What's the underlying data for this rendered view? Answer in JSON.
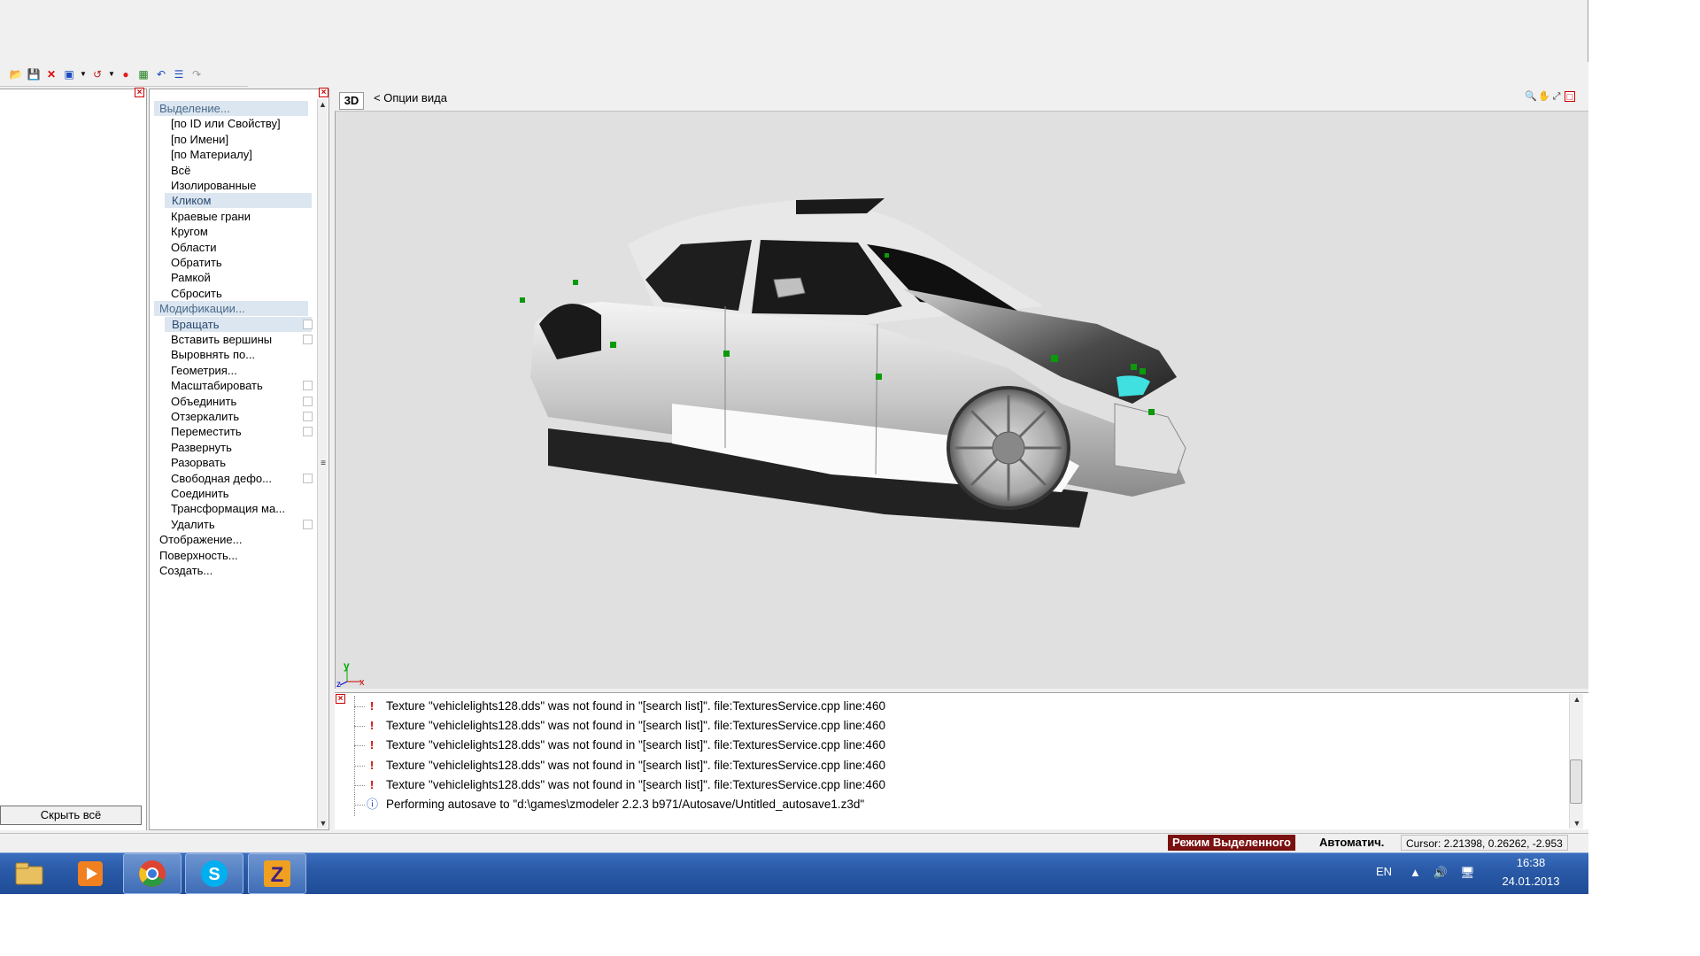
{
  "toolbar": {
    "icons": [
      "open-icon",
      "save-icon",
      "delete-icon",
      "import-icon",
      "dropdown-arrow",
      "undo-group-icon",
      "dropdown-arrow",
      "record-icon",
      "render-icon",
      "undo-icon",
      "properties-icon",
      "redo-icon"
    ]
  },
  "left_panel": {
    "hide_all_button": "Скрыть всё"
  },
  "tree": {
    "sections": [
      {
        "label": "Выделение...",
        "kind": "sect"
      },
      {
        "label": "[по ID или Свойству]",
        "kind": "item"
      },
      {
        "label": "[по Имени]",
        "kind": "item"
      },
      {
        "label": "[по Материалу]",
        "kind": "item"
      },
      {
        "label": "Всё",
        "kind": "item"
      },
      {
        "label": "Изолированные",
        "kind": "item"
      },
      {
        "label": "Кликом",
        "kind": "sel"
      },
      {
        "label": "Краевые грани",
        "kind": "item"
      },
      {
        "label": "Кругом",
        "kind": "item"
      },
      {
        "label": "Области",
        "kind": "item"
      },
      {
        "label": "Обратить",
        "kind": "item"
      },
      {
        "label": "Рамкой",
        "kind": "item"
      },
      {
        "label": "Сбросить",
        "kind": "item"
      },
      {
        "label": "Модификации...",
        "kind": "sect"
      },
      {
        "label": "Вращать",
        "kind": "sel",
        "check": true
      },
      {
        "label": "Вставить вершины",
        "kind": "item",
        "check": true
      },
      {
        "label": "Выровнять по...",
        "kind": "item"
      },
      {
        "label": "Геометрия...",
        "kind": "item"
      },
      {
        "label": "Масштабировать",
        "kind": "item",
        "check": true
      },
      {
        "label": "Объединить",
        "kind": "item",
        "check": true
      },
      {
        "label": "Отзеркалить",
        "kind": "item",
        "check": true
      },
      {
        "label": "Переместить",
        "kind": "item",
        "check": true
      },
      {
        "label": "Развернуть",
        "kind": "item"
      },
      {
        "label": "Разорвать",
        "kind": "item"
      },
      {
        "label": "Свободная дефо...",
        "kind": "item",
        "check": true
      },
      {
        "label": "Соединить",
        "kind": "item"
      },
      {
        "label": "Трансформация ма...",
        "kind": "item"
      },
      {
        "label": "Удалить",
        "kind": "item",
        "check": true
      },
      {
        "label": "Отображение...",
        "kind": "root"
      },
      {
        "label": "Поверхность...",
        "kind": "root"
      },
      {
        "label": "Создать...",
        "kind": "root"
      }
    ]
  },
  "viewport": {
    "mode_button": "3D",
    "options_label": "<  Опции вида",
    "axis_y": "y",
    "axis_x": "x",
    "axis_z": "z"
  },
  "log": {
    "entries": [
      {
        "type": "error",
        "text": "Texture \"vehiclelights128.dds\" was not found in \"[search list]\". file:TexturesService.cpp line:460"
      },
      {
        "type": "error",
        "text": "Texture \"vehiclelights128.dds\" was not found in \"[search list]\". file:TexturesService.cpp line:460"
      },
      {
        "type": "error",
        "text": "Texture \"vehiclelights128.dds\" was not found in \"[search list]\". file:TexturesService.cpp line:460"
      },
      {
        "type": "error",
        "text": "Texture \"vehiclelights128.dds\" was not found in \"[search list]\". file:TexturesService.cpp line:460"
      },
      {
        "type": "error",
        "text": "Texture \"vehiclelights128.dds\" was not found in \"[search list]\". file:TexturesService.cpp line:460"
      },
      {
        "type": "info",
        "text": "Performing autosave to \"d:\\games\\zmodeler 2.2.3 b971/Autosave/Untitled_autosave1.z3d\""
      }
    ]
  },
  "status": {
    "mode": "Режим Выделенного",
    "auto": "Автоматич.",
    "cursor": "Cursor: 2.21398, 0.26262, -2.953"
  },
  "taskbar": {
    "apps": [
      {
        "name": "explorer-icon",
        "color": "#e8c060"
      },
      {
        "name": "media-player-icon",
        "color": "#f08020"
      },
      {
        "name": "chrome-icon",
        "color": "#dd4433"
      },
      {
        "name": "skype-icon",
        "color": "#00aff0"
      },
      {
        "name": "zmodeler-icon",
        "color": "#f0a020"
      }
    ],
    "lang": "EN",
    "time": "16:38",
    "date": "24.01.2013"
  }
}
